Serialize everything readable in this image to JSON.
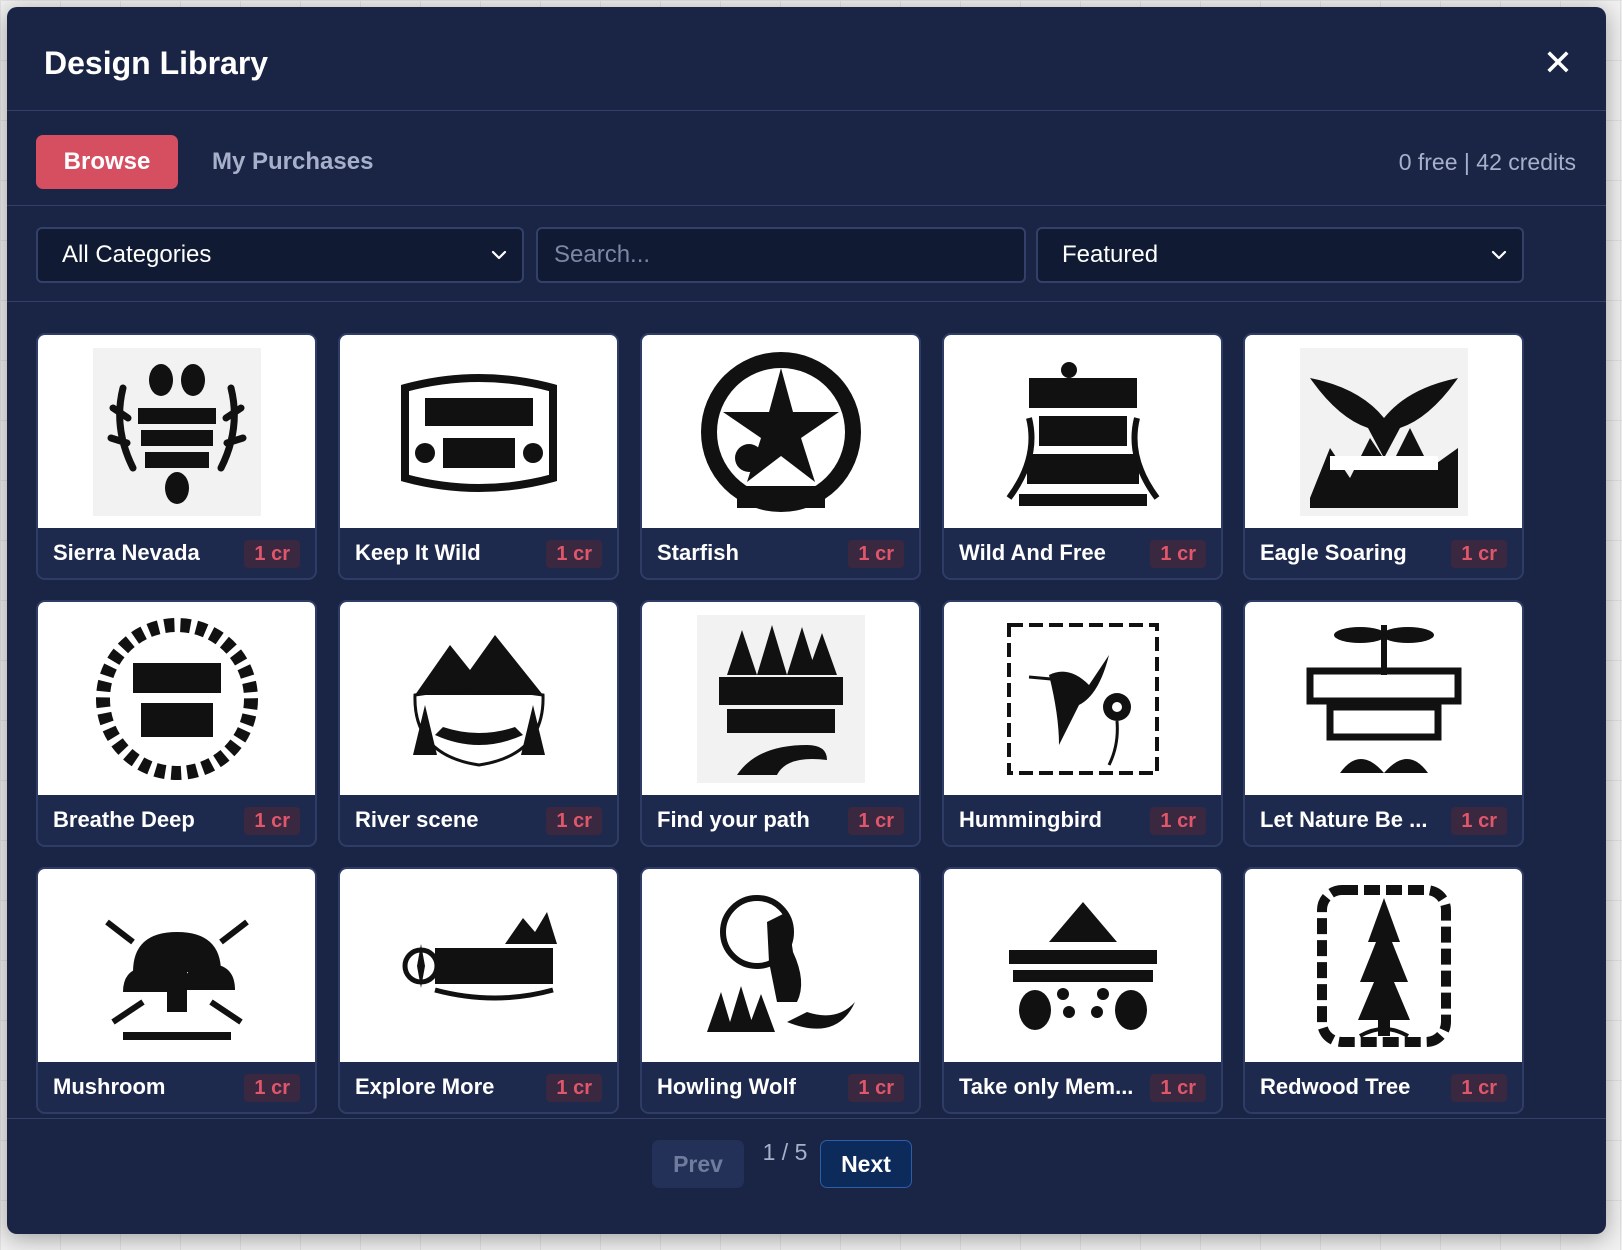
{
  "modal": {
    "title": "Design Library",
    "close_icon": "close-icon"
  },
  "tabs": {
    "browse_label": "Browse",
    "purchases_label": "My Purchases",
    "credits_text": "0 free | 42 credits"
  },
  "filters": {
    "category_value": "All Categories",
    "search_placeholder": "Search...",
    "sort_value": "Featured"
  },
  "designs": [
    {
      "name": "Sierra Nevada",
      "price": "1 cr",
      "icon": "antlers-pinecone-icon"
    },
    {
      "name": "Keep It Wild",
      "price": "1 cr",
      "icon": "bear-paw-banner-icon"
    },
    {
      "name": "Starfish",
      "price": "1 cr",
      "icon": "starfish-circle-icon"
    },
    {
      "name": "Wild And Free",
      "price": "1 cr",
      "icon": "wildflowers-icon"
    },
    {
      "name": "Eagle Soaring",
      "price": "1 cr",
      "icon": "eagle-icon"
    },
    {
      "name": "Breathe Deep",
      "price": "1 cr",
      "icon": "leaf-wreath-icon"
    },
    {
      "name": "River scene",
      "price": "1 cr",
      "icon": "mountain-canoe-icon"
    },
    {
      "name": "Find your path",
      "price": "1 cr",
      "icon": "forest-path-icon"
    },
    {
      "name": "Hummingbird",
      "price": "1 cr",
      "icon": "hummingbird-icon"
    },
    {
      "name": "Let Nature Be ...",
      "price": "1 cr",
      "icon": "dragonfly-icon"
    },
    {
      "name": "Mushroom",
      "price": "1 cr",
      "icon": "mushroom-icon"
    },
    {
      "name": "Explore More",
      "price": "1 cr",
      "icon": "compass-mountain-icon"
    },
    {
      "name": "Howling Wolf",
      "price": "1 cr",
      "icon": "wolf-moon-icon"
    },
    {
      "name": "Take only Mem...",
      "price": "1 cr",
      "icon": "footprints-icon"
    },
    {
      "name": "Redwood Tree",
      "price": "1 cr",
      "icon": "redwood-tree-icon"
    }
  ],
  "pagination": {
    "prev_label": "Prev",
    "page_text": "1 / 5",
    "next_label": "Next"
  }
}
